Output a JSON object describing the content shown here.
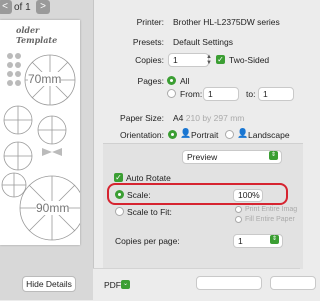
{
  "left": {
    "page_counter": "of 1",
    "prev_glyph": "<",
    "next_glyph": ">",
    "paper_title": "older Template",
    "labels": [
      "70mm",
      "90mm"
    ],
    "hide_details": "Hide Details"
  },
  "form": {
    "printer_label": "Printer:",
    "printer_value": "Brother HL-L2375DW series",
    "presets_label": "Presets:",
    "presets_value": "Default Settings",
    "copies_label": "Copies:",
    "copies_value": "1",
    "two_sided_label": "Two-Sided",
    "pages_label": "Pages:",
    "pages_all": "All",
    "pages_from": "From:",
    "pages_from_value": "1",
    "pages_to": "to:",
    "pages_to_value": "1",
    "paper_size_label": "Paper Size:",
    "paper_size_value": "A4",
    "paper_size_dims": "210 by 297 mm",
    "orientation_label": "Orientation:",
    "portrait_label": "Portrait",
    "landscape_label": "Landscape",
    "preview_value": "Preview",
    "auto_rotate_label": "Auto Rotate",
    "scale_label": "Scale:",
    "scale_value": "100%",
    "scale_to_fit_label": "Scale to Fit:",
    "print_entire_image": "Print Entire Imag",
    "fill_entire_paper": "Fill Entire Paper",
    "copies_per_page_label": "Copies per page:",
    "copies_per_page_value": "1",
    "pdf_label": "PDF"
  },
  "colors": {
    "accent": "#3b9e33",
    "highlight": "#d62430"
  }
}
